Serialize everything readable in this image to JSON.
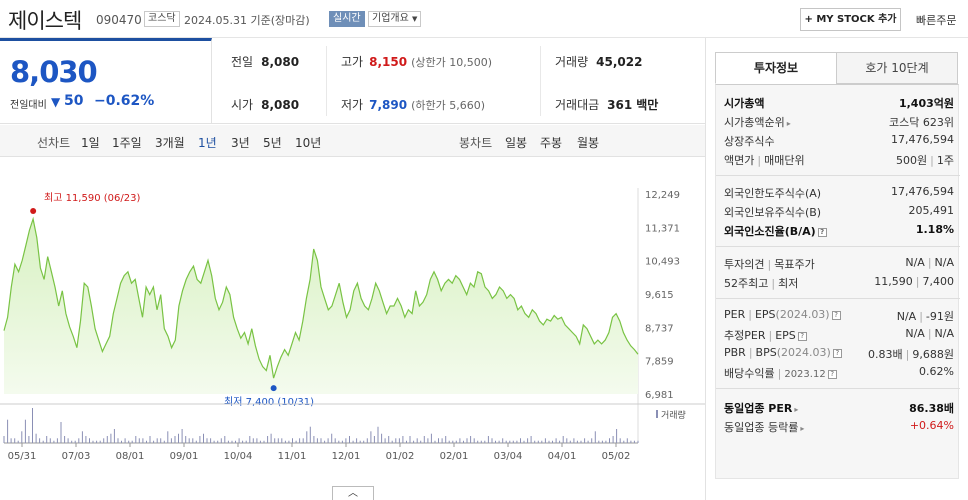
{
  "header": {
    "name": "제이스텍",
    "code": "090470",
    "market": "코스닥",
    "date": "2024.05.31",
    "basis": "기준(장마감)",
    "realtime": "실시간",
    "company_overview": "기업개요",
    "mystock": "+ MY STOCK 추가",
    "quick_order": "빠른주문"
  },
  "quote": {
    "price": "8,030",
    "change_label": "전일대비",
    "change_arrow": "▼",
    "change": "50",
    "change_pct": "−0.62%",
    "prev_label": "전일",
    "prev": "8,080",
    "open_label": "시가",
    "open": "8,080",
    "high_label": "고가",
    "high": "8,150",
    "upper_limit": "(상한가 10,500)",
    "low_label": "저가",
    "low": "7,890",
    "lower_limit": "(하한가 5,660)",
    "volume_label": "거래량",
    "volume": "45,022",
    "amount_label": "거래대금",
    "amount": "361",
    "amount_unit": "백만"
  },
  "periods": {
    "line_label": "선차트",
    "line": [
      "1일",
      "1주일",
      "3개월",
      "1년",
      "3년",
      "5년",
      "10년"
    ],
    "selected": "1년",
    "candle_label": "봉차트",
    "candle": [
      "일봉",
      "주봉",
      "월봉"
    ]
  },
  "chart_data": {
    "type": "area",
    "title": "",
    "ylim": [
      6981,
      12249
    ],
    "y_ticks": [
      "12,249",
      "11,371",
      "10,493",
      "9,615",
      "8,737",
      "7,859",
      "6,981"
    ],
    "x_ticks": [
      "05/31",
      "07/03",
      "08/01",
      "09/01",
      "10/04",
      "11/01",
      "12/01",
      "01/02",
      "02/01",
      "03/04",
      "04/01",
      "05/02"
    ],
    "high_label": "최고 11,590 (06/23)",
    "low_label": "최저 7,400 (10/31)",
    "volume_label": "거래량",
    "prices": [
      8650,
      9000,
      9800,
      10400,
      10200,
      10500,
      10900,
      11300,
      11590,
      11100,
      10300,
      10000,
      10600,
      10200,
      9800,
      9300,
      9700,
      9100,
      8750,
      8500,
      8200,
      8900,
      9900,
      9800,
      9300,
      8700,
      8400,
      8100,
      8300,
      8500,
      9100,
      9500,
      9900,
      10100,
      10200,
      9900,
      10000,
      9500,
      9000,
      9800,
      9600,
      9800,
      9200,
      9600,
      8700,
      8500,
      8200,
      8400,
      9300,
      9700,
      10000,
      10200,
      10350,
      10000,
      9900,
      10200,
      10500,
      10100,
      9500,
      9200,
      9400,
      9800,
      9600,
      9000,
      8700,
      8450,
      8600,
      8300,
      8700,
      8250,
      7900,
      7700,
      7600,
      8000,
      7400,
      7700,
      7950,
      8150,
      8000,
      8300,
      8600,
      8400,
      8900,
      9500,
      10000,
      10800,
      10500,
      9800,
      9500,
      9200,
      9300,
      9600,
      9900,
      9400,
      9000,
      9200,
      9700,
      9900,
      9500,
      9300,
      9200,
      9500,
      9900,
      9700,
      9400,
      9100,
      9300,
      9300,
      9500,
      9300,
      9000,
      9200,
      9100,
      9700,
      9300,
      9400,
      9600,
      10000,
      10200,
      10000,
      9700,
      9900,
      10000,
      9900,
      10100,
      10000,
      9800,
      9600,
      9900,
      9800,
      10200,
      10150,
      9800,
      9700,
      9500,
      9600,
      9800,
      9700,
      9500,
      9600,
      9500,
      9200,
      9300,
      9100,
      9000,
      9200,
      9100,
      8900,
      8800,
      8950,
      8900,
      9050,
      8950,
      9000,
      8800,
      8700,
      8600,
      8500,
      8300,
      8800,
      8700,
      8500,
      8300,
      8400,
      8300,
      8400,
      8600,
      9000,
      9100,
      8900,
      8600,
      8400,
      8250,
      8150,
      8030
    ],
    "volumes": [
      3,
      10,
      2,
      2,
      1,
      5,
      10,
      3,
      15,
      4,
      2,
      1,
      3,
      2,
      1,
      2,
      9,
      3,
      2,
      1,
      1,
      2,
      5,
      3,
      2,
      1,
      1,
      1,
      2,
      3,
      4,
      6,
      2,
      1,
      2,
      1,
      1,
      3,
      2,
      2,
      1,
      3,
      1,
      2,
      2,
      1,
      5,
      2,
      3,
      4,
      6,
      3,
      2,
      2,
      1,
      3,
      4,
      2,
      2,
      1,
      1,
      2,
      3,
      1,
      1,
      1,
      2,
      1,
      1,
      3,
      2,
      2,
      1,
      1,
      3,
      4,
      2,
      2,
      2,
      1,
      1,
      2,
      1,
      2,
      2,
      5,
      7,
      3,
      2,
      2,
      1,
      2,
      4,
      2,
      1,
      1,
      2,
      3,
      1,
      2,
      1,
      1,
      2,
      5,
      3,
      7,
      4,
      2,
      3,
      1,
      2,
      2,
      3,
      1,
      3,
      1,
      2,
      1,
      3,
      2,
      4,
      1,
      2,
      2,
      3,
      1,
      1,
      1,
      2,
      1,
      2,
      3,
      2,
      1,
      1,
      1,
      3,
      2,
      1,
      1,
      2,
      1,
      1,
      1,
      1,
      2,
      1,
      2,
      3,
      1,
      1,
      1,
      2,
      1,
      1,
      2,
      1,
      3,
      2,
      1,
      2,
      1,
      1,
      2,
      1,
      2,
      5,
      1,
      1,
      1,
      2,
      3,
      6,
      2,
      1,
      2,
      1,
      1,
      1
    ]
  },
  "panel": {
    "tab_active": "투자정보",
    "tab_other": "호가 10단계",
    "rows": {
      "mcap_k": "시가총액",
      "mcap_v": "1,403억원",
      "rank_k": "시가총액순위",
      "rank_v": "코스닥 623위",
      "shares_k": "상장주식수",
      "shares_v": "17,476,594",
      "par_k1": "액면가",
      "par_k2": "매매단위",
      "par_v1": "500원",
      "par_v2": "1주",
      "flimit_k": "외국인한도주식수(A)",
      "flimit_v": "17,476,594",
      "fhold_k": "외국인보유주식수(B)",
      "fhold_v": "205,491",
      "fratio_k": "외국인소진율(B/A)",
      "fratio_v": "1.18%",
      "opinion_k1": "투자의견",
      "opinion_k2": "목표주가",
      "opinion_v1": "N/A",
      "opinion_v2": "N/A",
      "w52_k1": "52주최고",
      "w52_k2": "최저",
      "w52_v1": "11,590",
      "w52_v2": "7,400",
      "per_k1": "PER",
      "per_k2": "EPS",
      "per_k3": "(2024.03)",
      "per_v1": "N/A",
      "per_v2": "-91원",
      "eper_k1": "추정PER",
      "eper_k2": "EPS",
      "eper_v1": "N/A",
      "eper_v2": "N/A",
      "pbr_k1": "PBR",
      "pbr_k2": "BPS",
      "pbr_k3": "(2024.03)",
      "pbr_v1": "0.83배",
      "pbr_v2": "9,688원",
      "div_k": "배당수익률",
      "div_k2": "2023.12",
      "div_v": "0.62%",
      "sper_k": "동일업종 PER",
      "sper_v": "86.38배",
      "srate_k": "동일업종 등락률",
      "srate_v": "+0.64%"
    }
  },
  "colors": {
    "up": "#d01a1a",
    "down": "#1d56c3",
    "line": "#79c344",
    "fill": "#e6f6d6"
  }
}
